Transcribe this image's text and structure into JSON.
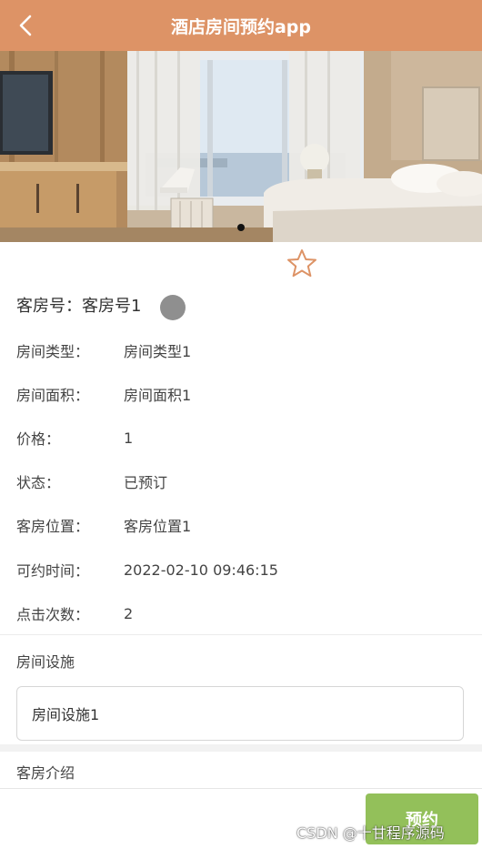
{
  "header": {
    "title": "酒店房间预约app",
    "back_icon": "chevron-left-icon",
    "color": "#dd9366"
  },
  "banner": {
    "slide_count": 1,
    "active_index": 0
  },
  "favorite": {
    "icon": "star-outline-icon",
    "color": "#dd9366"
  },
  "room": {
    "no_label": "客房号：",
    "no_value": "客房号1"
  },
  "details": [
    {
      "label": "房间类型：",
      "value": "房间类型1"
    },
    {
      "label": "房间面积：",
      "value": "房间面积1"
    },
    {
      "label": "价格：",
      "value": "1"
    },
    {
      "label": "状态：",
      "value": "已预订"
    },
    {
      "label": "客房位置：",
      "value": "客房位置1"
    },
    {
      "label": "可约时间：",
      "value": "2022-02-10 09:46:15"
    },
    {
      "label": "点击次数：",
      "value": "2"
    }
  ],
  "facilities": {
    "title": "房间设施",
    "value": "房间设施1"
  },
  "intro": {
    "title": "客房介绍"
  },
  "footer": {
    "book_label": "预约",
    "book_color": "#93c05a",
    "watermark": "CSDN @十甘程序源码"
  }
}
